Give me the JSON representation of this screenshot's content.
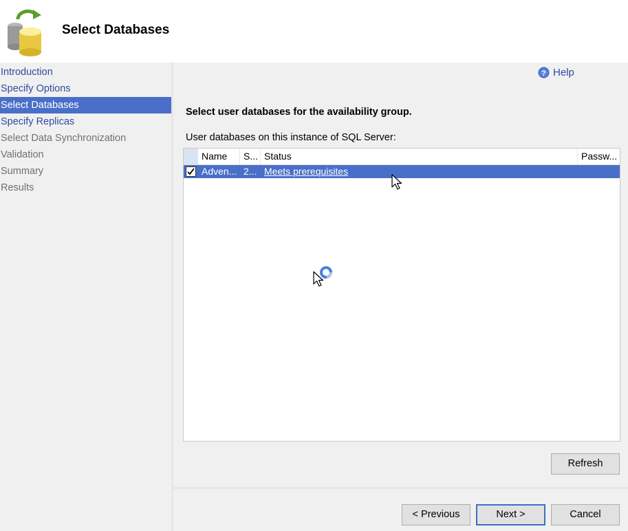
{
  "header": {
    "title": "Select Databases",
    "icon": "database-icon"
  },
  "sidebar": {
    "items": [
      {
        "label": "Introduction",
        "state": "link"
      },
      {
        "label": "Specify Options",
        "state": "link"
      },
      {
        "label": "Select Databases",
        "state": "selected"
      },
      {
        "label": "Specify Replicas",
        "state": "link"
      },
      {
        "label": "Select Data Synchronization",
        "state": "disabled"
      },
      {
        "label": "Validation",
        "state": "disabled"
      },
      {
        "label": "Summary",
        "state": "disabled"
      },
      {
        "label": "Results",
        "state": "disabled"
      }
    ]
  },
  "content": {
    "help_label": "Help",
    "prompt": "Select user databases for the availability group.",
    "sublabel": "User databases on this instance of SQL Server:"
  },
  "grid": {
    "columns": [
      "Name",
      "S...",
      "Status",
      "Passw..."
    ],
    "rows": [
      {
        "checked": true,
        "name": "Adven...",
        "size": "2...",
        "status": "Meets prerequisites",
        "password": ""
      }
    ]
  },
  "buttons": {
    "refresh": "Refresh",
    "previous": "< Previous",
    "next": "Next >",
    "cancel": "Cancel"
  },
  "colors": {
    "selection": "#4a6fc9",
    "link": "#2e4aa0",
    "panel": "#f0f0f0"
  }
}
